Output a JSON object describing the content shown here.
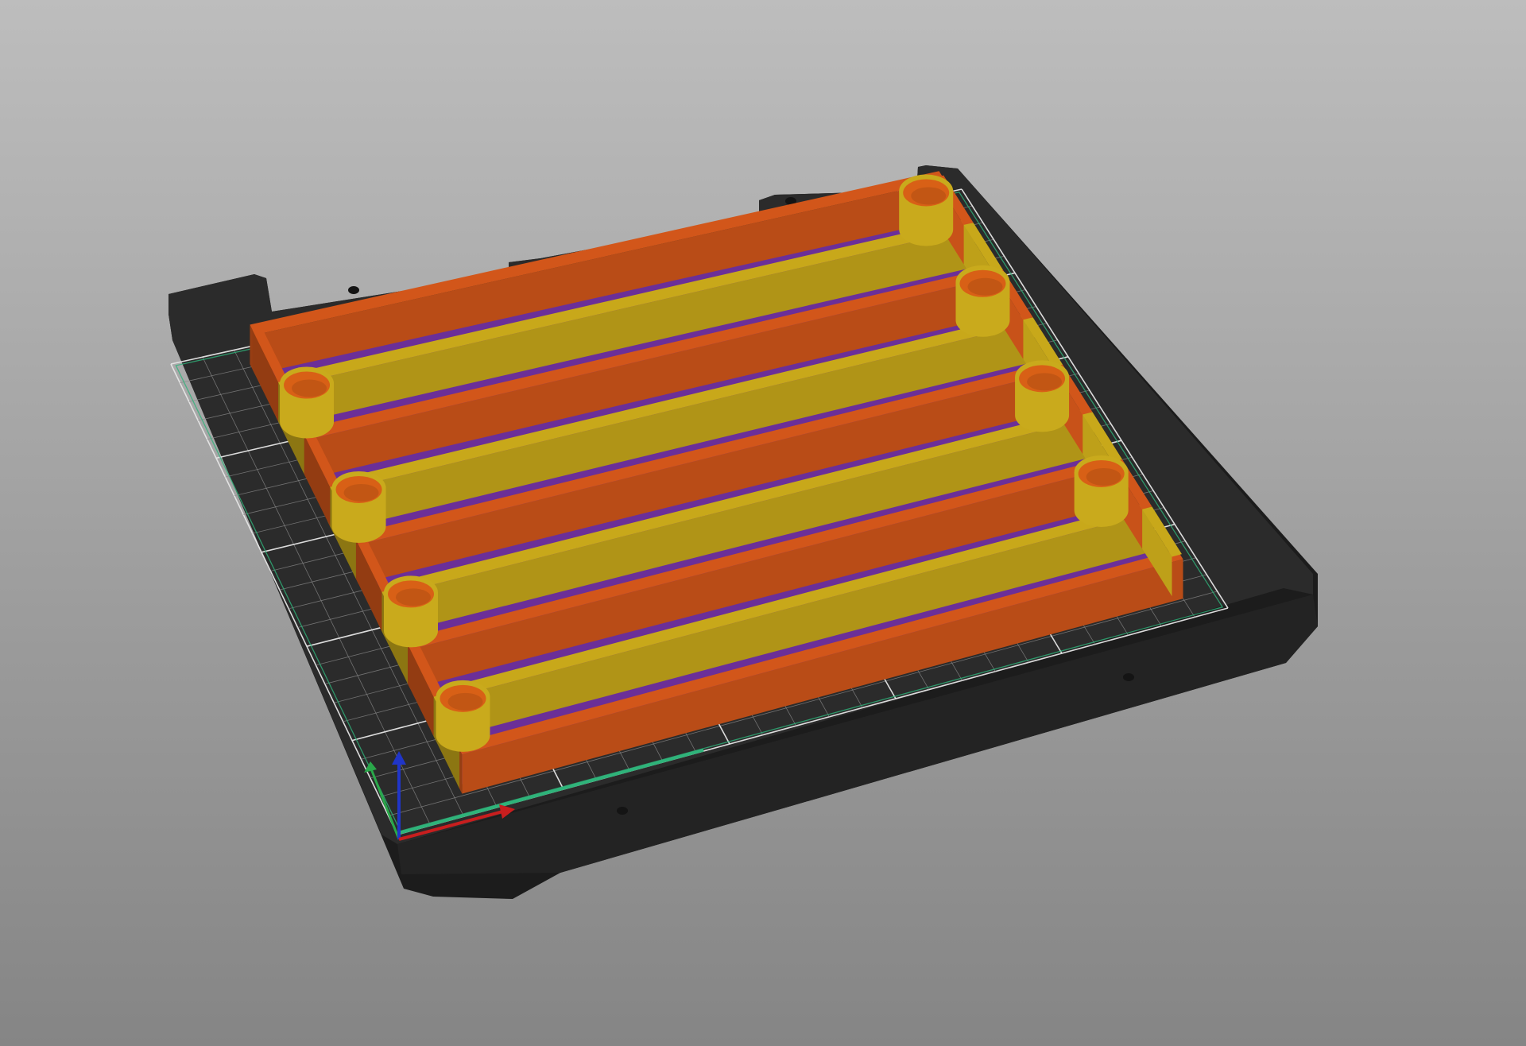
{
  "scene": {
    "background": {
      "top_color": "#bdbdbd",
      "bottom_color": "#858585"
    },
    "bed": {
      "surface_color": "#2b2b2b",
      "edge_color": "#1c1c1c",
      "grid_major_color": "#e6e6e6",
      "grid_minor_color": "#8a8a8a",
      "hole_color": "#141414"
    },
    "axes": {
      "x_color": "#c81e1e",
      "y_color": "#2aa84a",
      "z_color": "#2035c8",
      "boundary_color": "#2fb37a"
    },
    "model": {
      "kind": "tray",
      "compartments": 4,
      "wall_colors": [
        "#d2561a",
        "#c8a81a"
      ],
      "floor_color": "#6b2f98",
      "cup_colors": [
        "#d86016",
        "#c9aa1c"
      ]
    }
  }
}
